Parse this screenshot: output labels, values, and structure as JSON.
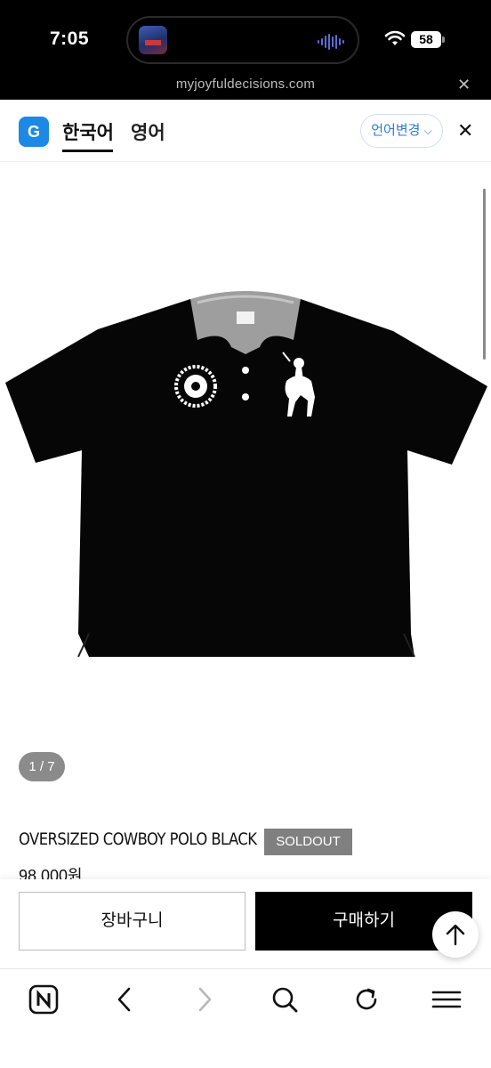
{
  "status": {
    "time": "7:05",
    "battery": "58",
    "url": "myjoyfuldecisions.com"
  },
  "translate_bar": {
    "logo": "G",
    "tab_korean": "한국어",
    "tab_english": "영어",
    "change_language": "언어변경"
  },
  "gallery": {
    "counter": "1 / 7"
  },
  "product": {
    "name": "OVERSIZED COWBOY POLO BLACK",
    "badge": "SOLDOUT",
    "price": "98.000원"
  },
  "actions": {
    "cart": "장바구니",
    "buy": "구매하기"
  },
  "colors": {
    "accent": "#1e88e5",
    "buy_button": "#000000",
    "badge": "#808080"
  },
  "icons": [
    "music-artwork-icon",
    "audio-wave-icon",
    "wifi-icon",
    "close-icon",
    "translate-logo-icon",
    "chevron-down-icon",
    "arrow-up-icon",
    "naver-icon",
    "back-icon",
    "forward-icon",
    "search-icon",
    "refresh-icon",
    "menu-icon"
  ]
}
